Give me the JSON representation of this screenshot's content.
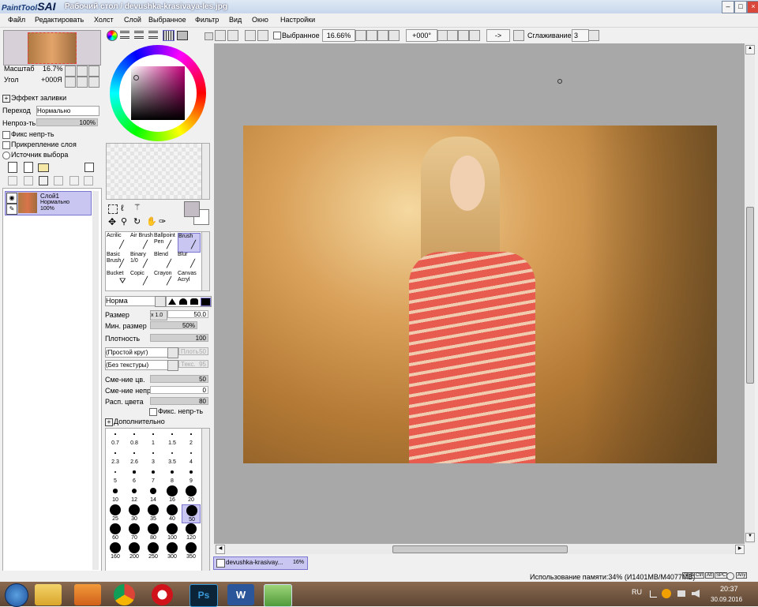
{
  "window": {
    "app_logo_small": "PaintTool",
    "app_logo_big": "SAI",
    "title": "Рабочий стол / devushka-krasivaya-les.jpg",
    "controls": {
      "minimize": "–",
      "maximize": "□",
      "close": "×"
    }
  },
  "menu": [
    "Файл",
    "Редактировать",
    "Холст",
    "Слой",
    "Выбранное",
    "Фильтр",
    "Вид",
    "Окно",
    "Настройки"
  ],
  "toolbar": {
    "selection_label": "Выбранное",
    "zoom": "16.66%",
    "rotation": "+000°",
    "flip_label": "->",
    "smoothing_label": "Сглаживание",
    "smoothing_value": "3"
  },
  "navigator": {
    "scale_label": "Масштаб",
    "scale_value": "16.7%",
    "angle_label": "Угол",
    "angle_value": "+000Я"
  },
  "layer_panel": {
    "effect_header": "Эффект заливки",
    "blend_label": "Переход",
    "blend_value": "Нормально",
    "opacity_label": "Непроз-ть",
    "opacity_value": "100%",
    "checks": [
      "Фикс непр-ть",
      "Прикрепление слоя",
      "Источник выбора"
    ],
    "layer": {
      "name": "Слой1",
      "mode": "Нормально",
      "opacity": "100%"
    }
  },
  "tools": {
    "brushes": [
      {
        "name": "Acrilic",
        "icon": "acrylic-brush-icon"
      },
      {
        "name": "Air Brush",
        "icon": "airbrush-icon"
      },
      {
        "name": "Ballpoint Pen",
        "icon": "pen-icon"
      },
      {
        "name": "Brush",
        "icon": "brush-icon"
      },
      {
        "name": "Basic Brush",
        "icon": "brush-icon"
      },
      {
        "name": "Binary 1/0",
        "icon": "binary-pen-icon"
      },
      {
        "name": "Blend",
        "icon": "blend-icon"
      },
      {
        "name": "Blur",
        "icon": "blur-icon"
      },
      {
        "name": "Bucket",
        "icon": "bucket-icon"
      },
      {
        "name": "Copic",
        "icon": "marker-icon"
      },
      {
        "name": "Crayon",
        "icon": "crayon-icon"
      },
      {
        "name": "Canvas Acryl",
        "icon": "brush-icon"
      }
    ]
  },
  "brush_settings": {
    "mode": "Норма",
    "size_label": "Размер",
    "size_mult": "x 1.0",
    "size_value": "50.0",
    "min_size_label": "Мин. размер",
    "min_size_value": "50%",
    "density_label": "Плотность",
    "density_value": "100",
    "shape": "(Простой круг)",
    "shape_value": "50",
    "shape_field": "Плоть",
    "texture": "(Без текстуры)",
    "texture_field": "Текс.",
    "texture_value": "95",
    "mix_label": "Сме-ние цв.",
    "mix_value": "50",
    "mix_opacity_label": "Сме-ние непр.",
    "mix_opacity_value": "0",
    "spread_label": "Расп. цвета",
    "spread_value": "80",
    "fix_opacity_label": "Фикс. непр-ть",
    "advanced_label": "Дополнительно"
  },
  "brush_sizes": [
    [
      "0.7",
      "0.8",
      "1",
      "1.5",
      "2"
    ],
    [
      "2.3",
      "2.6",
      "3",
      "3.5",
      "4"
    ],
    [
      "5",
      "6",
      "7",
      "8",
      "9"
    ],
    [
      "10",
      "12",
      "14",
      "16",
      "20"
    ],
    [
      "25",
      "30",
      "35",
      "40",
      "50"
    ],
    [
      "60",
      "70",
      "80",
      "100",
      "120"
    ],
    [
      "160",
      "200",
      "250",
      "300",
      "350"
    ]
  ],
  "document_tab": {
    "name": "devushka-krasivay...",
    "zoom": "16%"
  },
  "status": {
    "memory": "Использование памяти:34% (И1401MB/М4077MB)",
    "keys": [
      "Shift",
      "Ctrl",
      "Alt",
      "SPC",
      "Any"
    ]
  },
  "taskbar": {
    "lang": "RU",
    "time": "20:37",
    "date": "30.09.2016",
    "apps": [
      "start-orb",
      "file-explorer",
      "media-player",
      "chrome",
      "opera",
      "photoshop",
      "word",
      "paint-tool-sai"
    ]
  }
}
